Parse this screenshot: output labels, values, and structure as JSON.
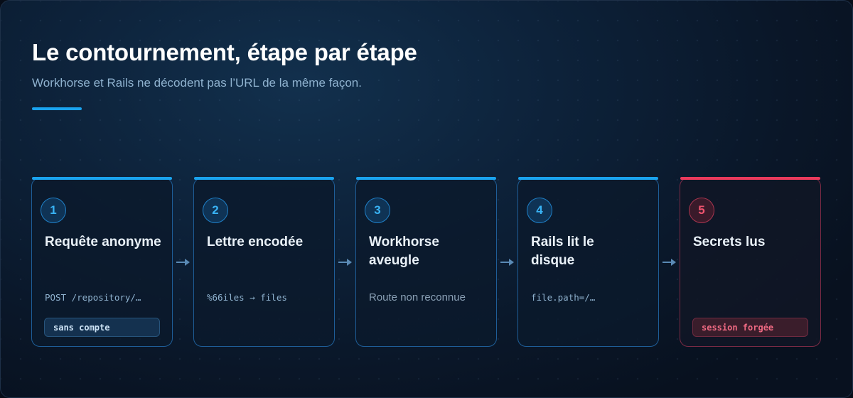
{
  "header": {
    "title": "Le contournement, étape par étape",
    "subtitle": "Workhorse et Rails ne décodent pas l’URL de la même façon."
  },
  "colors": {
    "accent": "#1aa3ee",
    "danger": "#e93a5c",
    "background": "#0d223a"
  },
  "steps": [
    {
      "number": "1",
      "title": "Requête anonyme",
      "detail": "POST /repository/…",
      "badge": "sans compte"
    },
    {
      "number": "2",
      "title": "Lettre encodée",
      "detail": "%66iles → files"
    },
    {
      "number": "3",
      "title": "Workhorse aveugle",
      "detail": "Route non reconnue"
    },
    {
      "number": "4",
      "title": "Rails lit le disque",
      "detail": "file.path=/…"
    },
    {
      "number": "5",
      "title": "Secrets lus",
      "badge": "session forgée"
    }
  ],
  "arrow_icon": "arrow-right-icon"
}
